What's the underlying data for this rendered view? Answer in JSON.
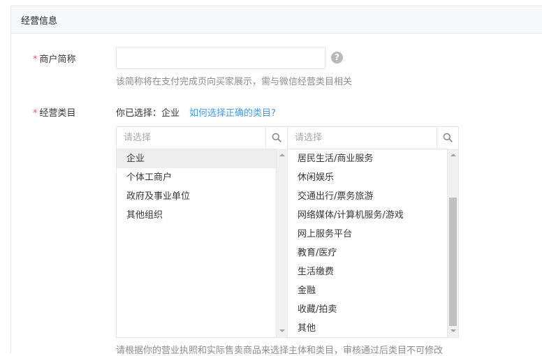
{
  "section": {
    "title": "经营信息"
  },
  "merchant_name": {
    "required_mark": "*",
    "label": "商户简称",
    "value": "",
    "placeholder": "",
    "help_icon": "?",
    "hint": "该简称将在支付完成页向买家展示，需与微信经营类目相关"
  },
  "category": {
    "required_mark": "*",
    "label": "经营类目",
    "selected_prefix": "你已选择：",
    "selected_value": "企业",
    "help_link": "如何选择正确的类目?",
    "left_picker": {
      "search_placeholder": "请选择",
      "items": [
        "企业",
        "个体工商户",
        "政府及事业单位",
        "其他组织"
      ],
      "active_index": 0
    },
    "right_picker": {
      "search_placeholder": "请选择",
      "items": [
        "居民生活/商业服务",
        "休闲娱乐",
        "交通出行/票务旅游",
        "网络媒体/计算机服务/游戏",
        "网上服务平台",
        "教育/医疗",
        "生活缴费",
        "金融",
        "收藏/拍卖",
        "其他"
      ]
    },
    "bottom_note": "请根据你的营业执照和实际售卖商品来选择主体和类目，审核通过后类目不可修改"
  },
  "icons": {
    "search": "search-icon",
    "help": "question-circle-icon",
    "scroll_up": "arrow-up-icon",
    "scroll_down": "arrow-down-icon"
  },
  "colors": {
    "required": "#e15f63",
    "link": "#459ae9",
    "hint": "#8d8d8d",
    "header_bg": "#f6f8f9"
  }
}
